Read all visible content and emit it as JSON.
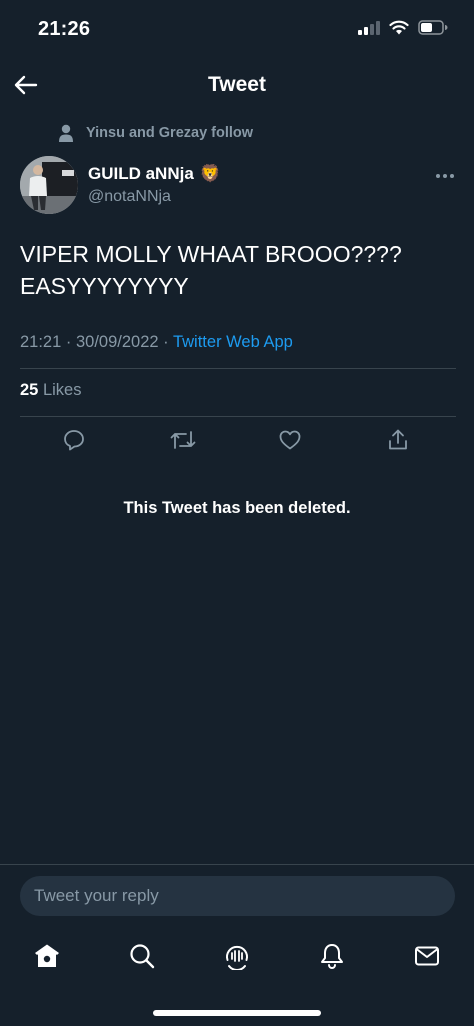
{
  "status_bar": {
    "time": "21:26",
    "icons": [
      "signal-icon",
      "wifi-icon",
      "battery-icon"
    ]
  },
  "header": {
    "back_icon": "arrow-left-icon",
    "title": "Tweet"
  },
  "social_context": {
    "icon": "person-icon",
    "text": "Yinsu and Grezay follow"
  },
  "author": {
    "name": "GUILD aNNja",
    "emoji": "🦁",
    "handle": "@notaNNja",
    "more_icon": "more-horizontal-icon"
  },
  "tweet": {
    "text": "VIPER MOLLY WHAAT BROOO????\nEASYYYYYYYY",
    "time": "21:21",
    "separator1": "·",
    "date": "30/09/2022",
    "separator2": "·",
    "source": "Twitter Web App"
  },
  "stats": {
    "likes_count": "25",
    "likes_label": "Likes"
  },
  "actions": [
    "reply-icon",
    "retweet-icon",
    "like-icon",
    "share-icon"
  ],
  "deleted_notice": "This Tweet has been deleted.",
  "reply": {
    "placeholder": "Tweet your reply"
  },
  "tabbar": [
    "home-icon",
    "search-icon",
    "spaces-icon",
    "notifications-icon",
    "messages-icon"
  ],
  "colors": {
    "background": "#15202b",
    "secondary_text": "#8899a6",
    "link": "#1d9bf0",
    "divider": "#38444d",
    "input_bg": "#253341"
  }
}
